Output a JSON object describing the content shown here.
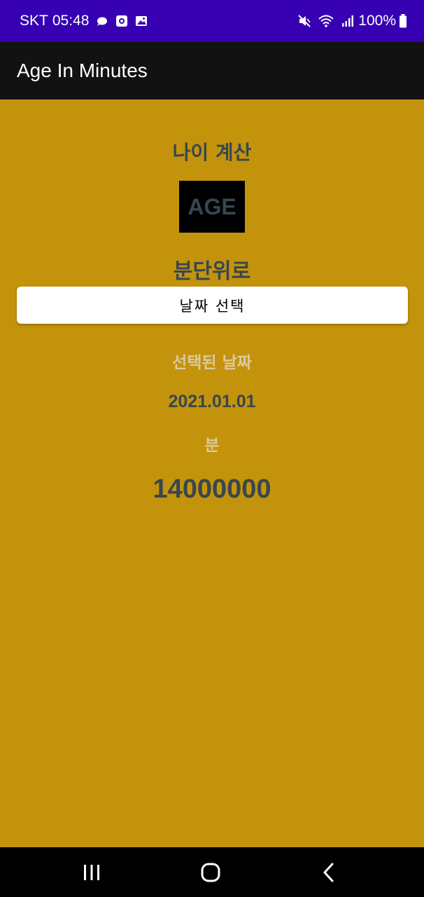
{
  "status_bar": {
    "carrier": "SKT",
    "time": "05:48",
    "battery": "100%",
    "icons_left": [
      "chat-bubble-icon",
      "screen-record-icon",
      "gallery-icon"
    ],
    "icons_right": [
      "mute-icon",
      "wifi-icon",
      "signal-icon",
      "battery-icon"
    ]
  },
  "app_bar": {
    "title": "Age In Minutes"
  },
  "main": {
    "title": "나이 계산",
    "logo_text": "AGE",
    "subtitle": "분단위로",
    "select_button_label": "날짜 선택",
    "selected_date_label": "선택된 날짜",
    "selected_date": "2021.01.01",
    "minutes_label": "분",
    "minutes_value": "14000000"
  },
  "nav_bar": {
    "buttons": [
      "recent-apps-icon",
      "home-icon",
      "back-icon"
    ]
  },
  "colors": {
    "status_bar": "#3700b3",
    "app_bar": "#121212",
    "background": "#c3930c",
    "text_dark": "#37474f",
    "text_light": "#dbc9a0",
    "nav_bar": "#000000"
  }
}
